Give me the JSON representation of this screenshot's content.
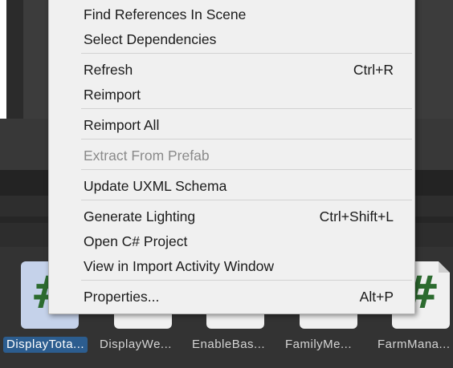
{
  "menu": {
    "items": [
      {
        "label": "Find References In Scene",
        "shortcut": "",
        "enabled": true
      },
      {
        "label": "Select Dependencies",
        "shortcut": "",
        "enabled": true
      },
      {
        "label": "Refresh",
        "shortcut": "Ctrl+R",
        "enabled": true
      },
      {
        "label": "Reimport",
        "shortcut": "",
        "enabled": true
      },
      {
        "label": "Reimport All",
        "shortcut": "",
        "enabled": true
      },
      {
        "label": "Extract From Prefab",
        "shortcut": "",
        "enabled": false
      },
      {
        "label": "Update UXML Schema",
        "shortcut": "",
        "enabled": true
      },
      {
        "label": "Generate Lighting",
        "shortcut": "Ctrl+Shift+L",
        "enabled": true
      },
      {
        "label": "Open C# Project",
        "shortcut": "",
        "enabled": true
      },
      {
        "label": "View in Import Activity Window",
        "shortcut": "",
        "enabled": true
      },
      {
        "label": "Properties...",
        "shortcut": "Alt+P",
        "enabled": true
      }
    ]
  },
  "assets": [
    {
      "label": "DisplayTota...",
      "icon": "csharp-script-icon",
      "glyph": "#",
      "selected": true
    },
    {
      "label": "DisplayWe...",
      "icon": "csharp-script-icon",
      "glyph": "#",
      "selected": false
    },
    {
      "label": "EnableBas...",
      "icon": "csharp-script-icon",
      "glyph": "#",
      "selected": false
    },
    {
      "label": "FamilyMe...",
      "icon": "csharp-script-icon",
      "glyph": "#",
      "selected": false
    },
    {
      "label": "FarmMana...",
      "icon": "csharp-script-icon",
      "glyph": "#",
      "selected": false
    }
  ],
  "colors": {
    "menu_bg": "#f0f0f0",
    "selection": "#2c5d8f",
    "script_icon_hash": "#2c6b2f"
  }
}
